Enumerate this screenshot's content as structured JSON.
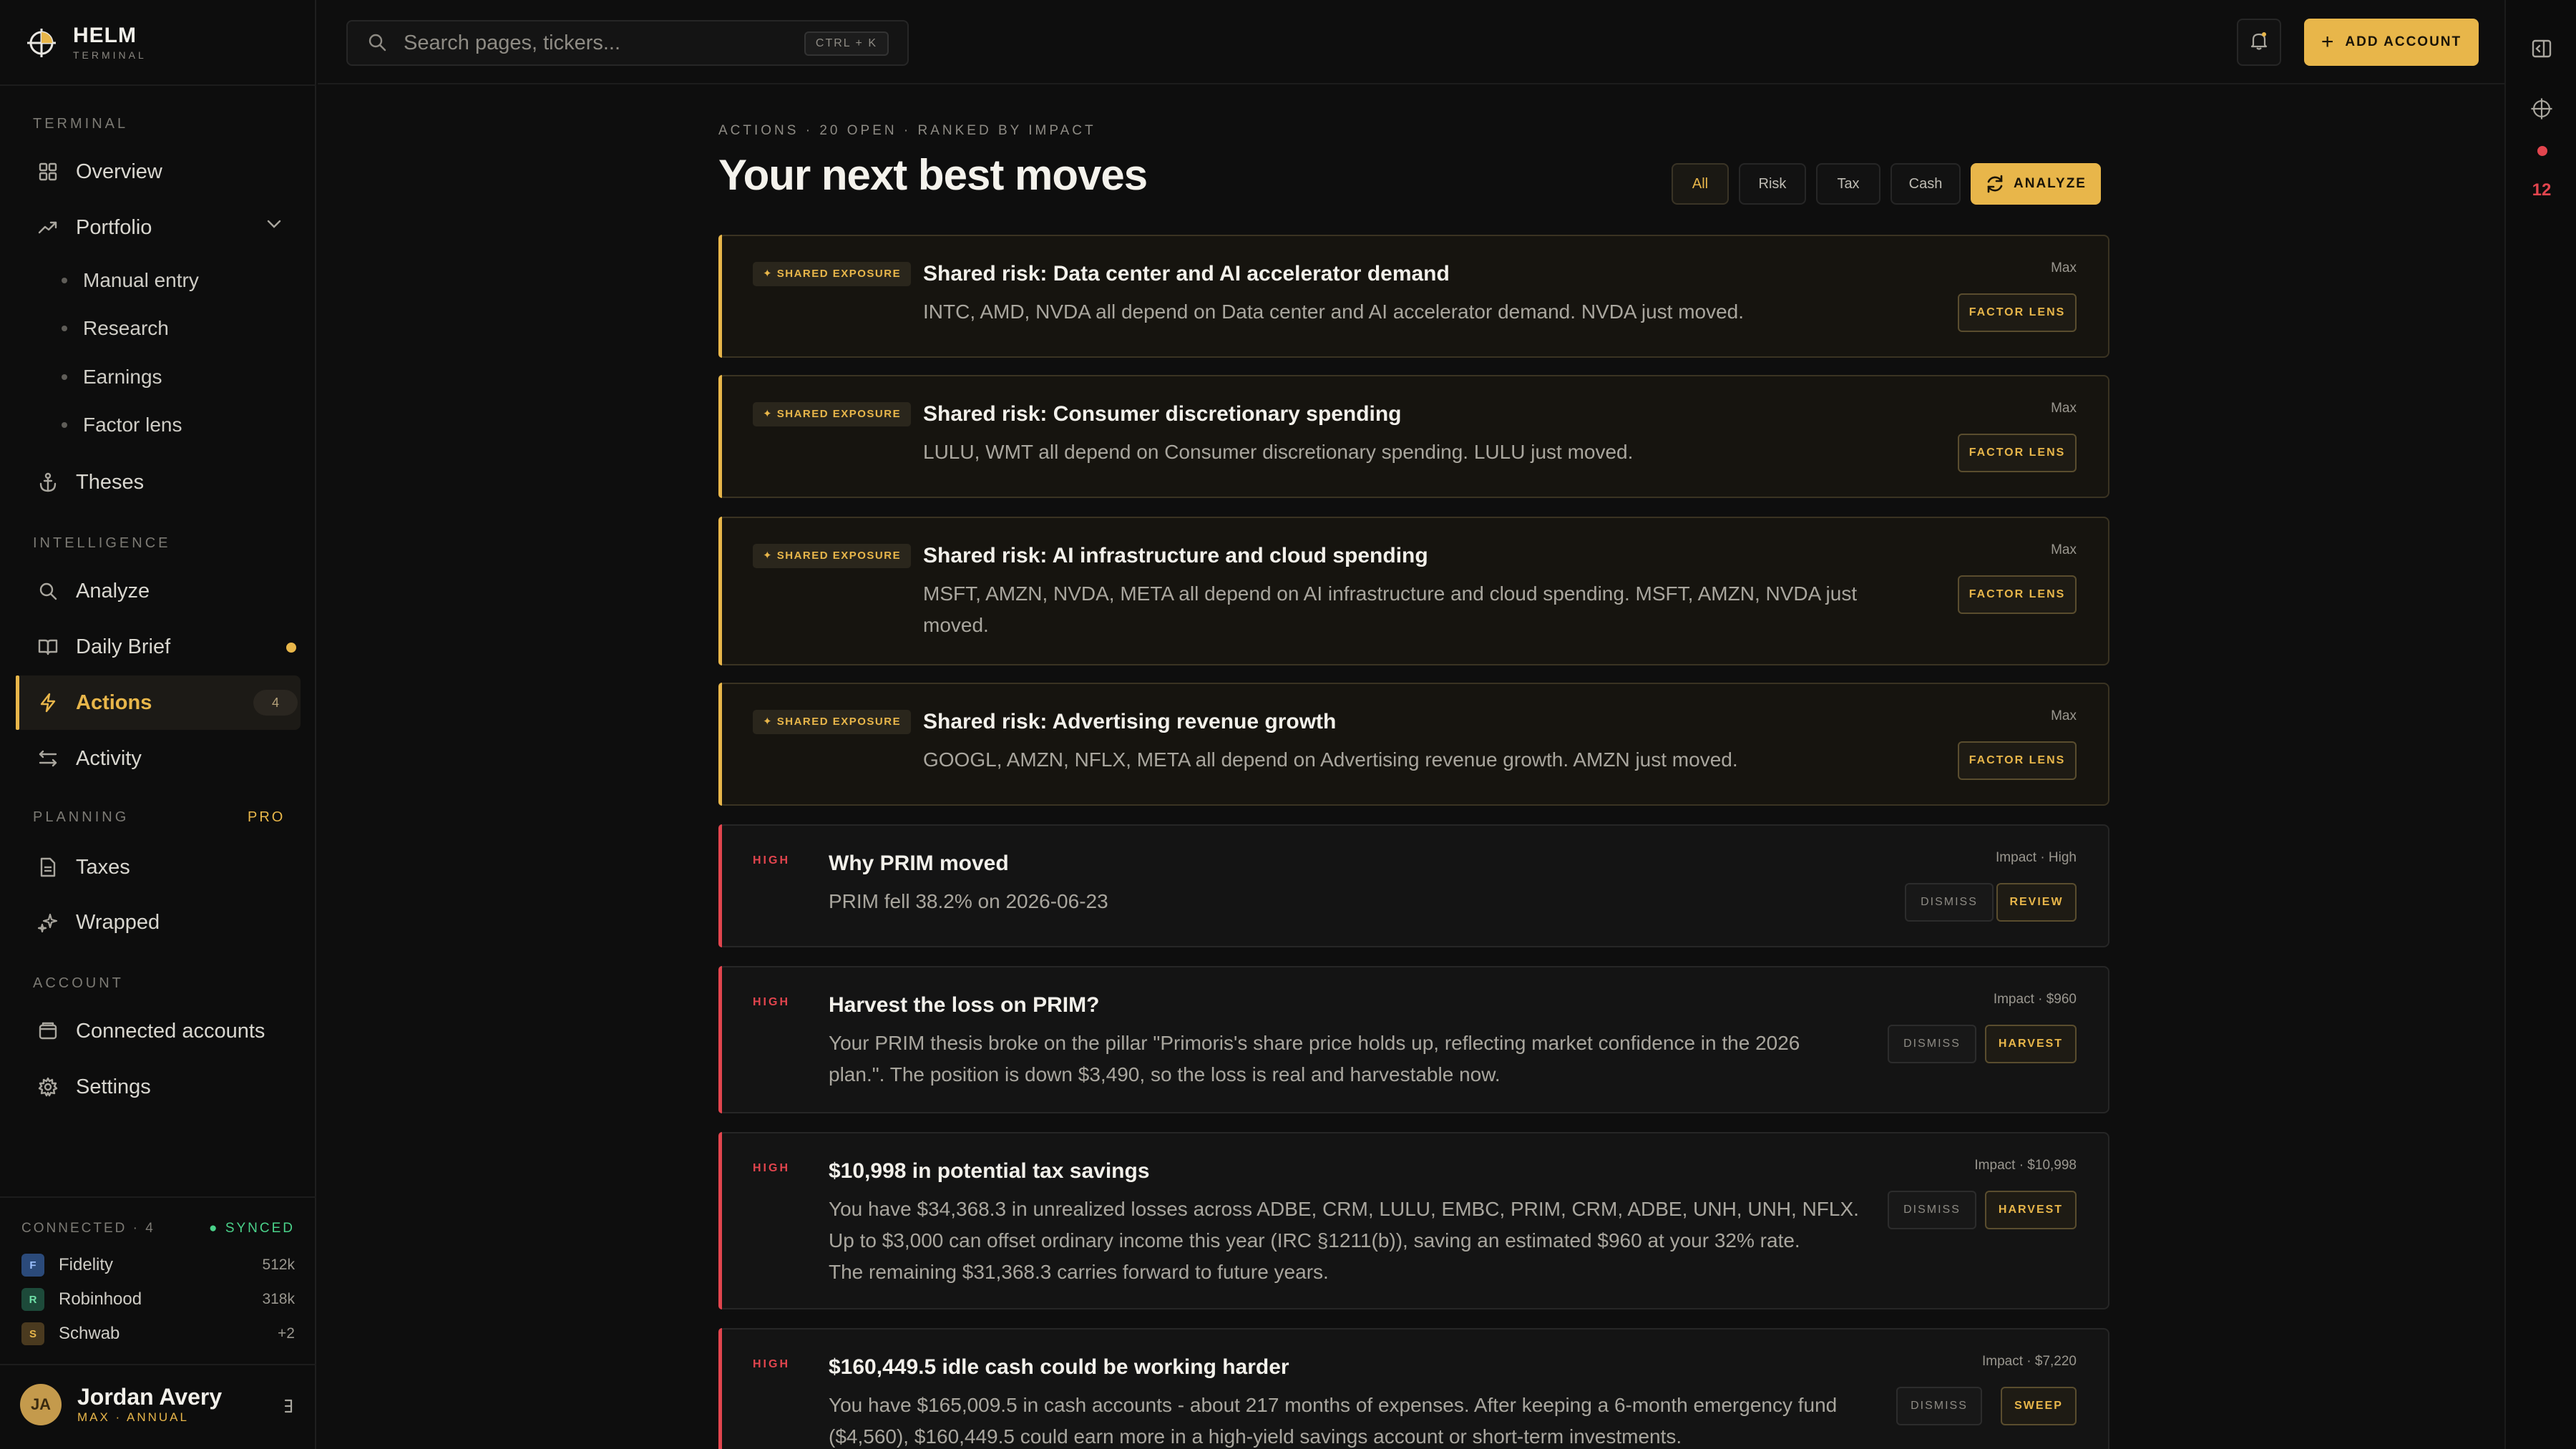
{
  "brand": {
    "name": "HELM",
    "sub": "TERMINAL"
  },
  "sidebar": {
    "sections": {
      "terminal": "TERMINAL",
      "intelligence": "INTELLIGENCE",
      "planning": "PLANNING",
      "planning_badge": "PRO",
      "account": "ACCOUNT"
    },
    "items": {
      "overview": "Overview",
      "portfolio": "Portfolio",
      "manual_entry": "Manual entry",
      "research": "Research",
      "earnings": "Earnings",
      "factor_lens": "Factor lens",
      "theses": "Theses",
      "analyze": "Analyze",
      "daily_brief": "Daily Brief",
      "actions": "Actions",
      "actions_count": "4",
      "activity": "Activity",
      "taxes": "Taxes",
      "wrapped": "Wrapped",
      "connected_accounts": "Connected accounts",
      "settings": "Settings"
    },
    "connected": {
      "label": "CONNECTED · 4",
      "status": "SYNCED",
      "accounts": [
        {
          "initial": "F",
          "name": "Fidelity",
          "value": "512k",
          "color": "#2b4a7a",
          "text": "#9cc0ff"
        },
        {
          "initial": "R",
          "name": "Robinhood",
          "value": "318k",
          "color": "#1d4a3a",
          "text": "#6fe0a8"
        },
        {
          "initial": "S",
          "name": "Schwab",
          "value": "+2",
          "color": "#4a3a1f",
          "text": "#e8b64a"
        }
      ]
    },
    "user": {
      "initials": "JA",
      "name": "Jordan Avery",
      "plan": "MAX · ANNUAL"
    }
  },
  "topbar": {
    "search_placeholder": "Search pages, tickers...",
    "shortcut": "CTRL + K",
    "add_account": "ADD ACCOUNT",
    "add_icon": "+"
  },
  "rail": {
    "count": "12"
  },
  "main": {
    "eyebrow": "ACTIONS · 20 OPEN · RANKED BY IMPACT",
    "title": "Your next best moves",
    "filters": [
      "All",
      "Risk",
      "Tax",
      "Cash"
    ],
    "analyze": "ANALYZE",
    "cards": [
      {
        "tag": "✦ SHARED EXPOSURE",
        "title": "Shared risk: Data center and AI accelerator demand",
        "body": [
          "INTC, AMD, NVDA all depend on Data center and AI accelerator demand. NVDA just moved."
        ],
        "impact": "Max",
        "action": "FACTOR LENS"
      },
      {
        "tag": "✦ SHARED EXPOSURE",
        "title": "Shared risk: Consumer discretionary spending",
        "body": [
          "LULU, WMT all depend on Consumer discretionary spending. LULU just moved."
        ],
        "impact": "Max",
        "action": "FACTOR LENS"
      },
      {
        "tag": "✦ SHARED EXPOSURE",
        "title": "Shared risk: AI infrastructure and cloud spending",
        "body": [
          "MSFT, AMZN, NVDA, META all depend on AI infrastructure and cloud spending. MSFT, AMZN, NVDA just",
          "moved."
        ],
        "impact": "Max",
        "action": "FACTOR LENS"
      },
      {
        "tag": "✦ SHARED EXPOSURE",
        "title": "Shared risk: Advertising revenue growth",
        "body": [
          "GOOGL, AMZN, NFLX, META all depend on Advertising revenue growth. AMZN just moved."
        ],
        "impact": "Max",
        "action": "FACTOR LENS"
      },
      {
        "tag": "HIGH",
        "title": "Why PRIM moved",
        "body": [
          "PRIM fell 38.2% on 2026-06-23"
        ],
        "impact": "Impact · High",
        "dismiss": "DISMISS",
        "action": "REVIEW"
      },
      {
        "tag": "HIGH",
        "title": "Harvest the loss on PRIM?",
        "body": [
          "Your PRIM thesis broke on the pillar \"Primoris's share price holds up, reflecting market confidence in the 2026",
          "plan.\". The position is down $3,490, so the loss is real and harvestable now."
        ],
        "impact": "Impact · $960",
        "dismiss": "DISMISS",
        "action": "HARVEST"
      },
      {
        "tag": "HIGH",
        "title": "$10,998 in potential tax savings",
        "body": [
          "You have $34,368.3 in unrealized losses across ADBE, CRM, LULU, EMBC, PRIM, CRM, ADBE, UNH, UNH, NFLX.",
          "Up to $3,000 can offset ordinary income this year (IRC §1211(b)), saving an estimated $960 at your 32% rate.",
          "The remaining $31,368.3 carries forward to future years."
        ],
        "impact": "Impact · $10,998",
        "dismiss": "DISMISS",
        "action": "HARVEST"
      },
      {
        "tag": "HIGH",
        "title": "$160,449.5 idle cash could be working harder",
        "body": [
          "You have $165,009.5 in cash accounts - about 217 months of expenses. After keeping a 6-month emergency fund",
          "($4,560), $160,449.5 could earn more in a high-yield savings account or short-term investments."
        ],
        "impact": "Impact · $7,220",
        "dismiss": "DISMISS",
        "action": "SWEEP"
      }
    ]
  },
  "colors": {
    "accent": "#e8b64a",
    "danger": "#e2454e",
    "success": "#4ad28a"
  }
}
